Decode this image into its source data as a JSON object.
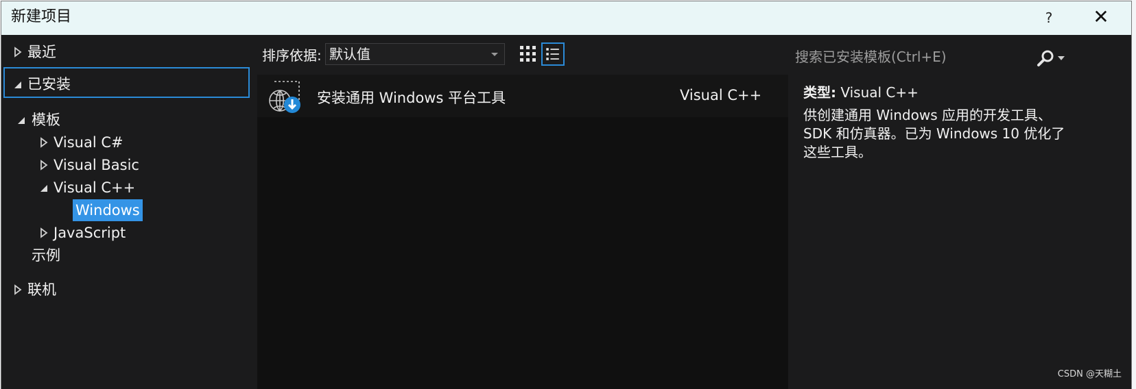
{
  "window": {
    "title": "新建项目",
    "help": "?",
    "close_glyph": "✕"
  },
  "left_tree": {
    "recent": "最近",
    "installed": "已安装",
    "templates": "模板",
    "visual_cs": "Visual C#",
    "visual_basic": "Visual Basic",
    "visual_cpp": "Visual C++",
    "windows": "Windows",
    "javascript": "JavaScript",
    "samples": "示例",
    "online": "联机"
  },
  "toolbar": {
    "sort_label": "排序依据:",
    "sort_value": "默认值"
  },
  "templates": [
    {
      "name": "安装通用 Windows 平台工具",
      "language": "Visual C++"
    }
  ],
  "search": {
    "placeholder": "搜索已安装模板(Ctrl+E)"
  },
  "details": {
    "type_label": "类型:",
    "type_value": "Visual C++",
    "description": "供创建通用 Windows 应用的开发工具、SDK 和仿真器。已为 Windows 10 优化了这些工具。"
  },
  "watermark": "CSDN @天糊土",
  "colors": {
    "accent": "#3494e6",
    "background": "#1b1b1c",
    "titlebar": "#e9f6f7"
  }
}
